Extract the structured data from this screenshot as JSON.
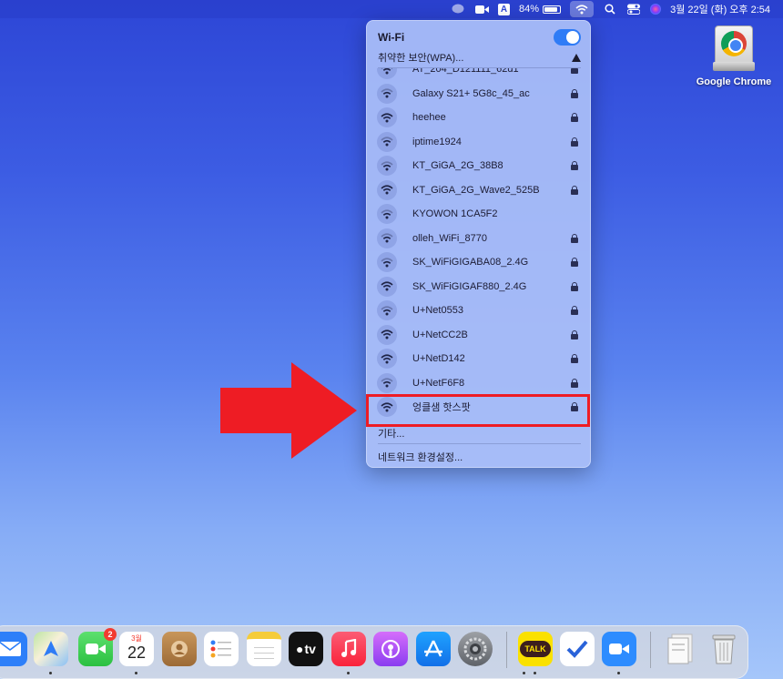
{
  "menubar": {
    "input_source": "A",
    "battery_percent": "84%",
    "battery_level": 0.84,
    "datetime": "3월 22일 (화) 오후 2:54"
  },
  "desktop": {
    "drive_label": "Google Chrome"
  },
  "wifi_menu": {
    "title": "Wi-Fi",
    "toggle_on": true,
    "current_network": "취약한 보안(WPA)...",
    "networks": [
      {
        "name": "AT_204_D121111_62d1",
        "secured": true
      },
      {
        "name": "Galaxy S21+ 5G8c_45_ac",
        "secured": true
      },
      {
        "name": "heehee",
        "secured": true
      },
      {
        "name": "iptime1924",
        "secured": true
      },
      {
        "name": "KT_GiGA_2G_38B8",
        "secured": true
      },
      {
        "name": "KT_GiGA_2G_Wave2_525B",
        "secured": true
      },
      {
        "name": "KYOWON 1CA5F2",
        "secured": false
      },
      {
        "name": "olleh_WiFi_8770",
        "secured": true
      },
      {
        "name": "SK_WiFiGIGABA08_2.4G",
        "secured": true
      },
      {
        "name": "SK_WiFiGIGAF880_2.4G",
        "secured": true
      },
      {
        "name": "U+Net0553",
        "secured": true
      },
      {
        "name": "U+NetCC2B",
        "secured": true
      },
      {
        "name": "U+NetD142",
        "secured": true
      },
      {
        "name": "U+NetF6F8",
        "secured": true
      },
      {
        "name": "엉클샘 핫스팟",
        "secured": true
      }
    ],
    "other": "기타...",
    "settings": "네트워크 환경설정..."
  },
  "dock": {
    "facetime_badge": "2",
    "calendar_month": "3월",
    "calendar_day": "22",
    "tv_label": "tv",
    "talk_label": "TALK"
  },
  "colors": {
    "accent": "#2f7cf6",
    "highlight": "#ee1c24"
  }
}
